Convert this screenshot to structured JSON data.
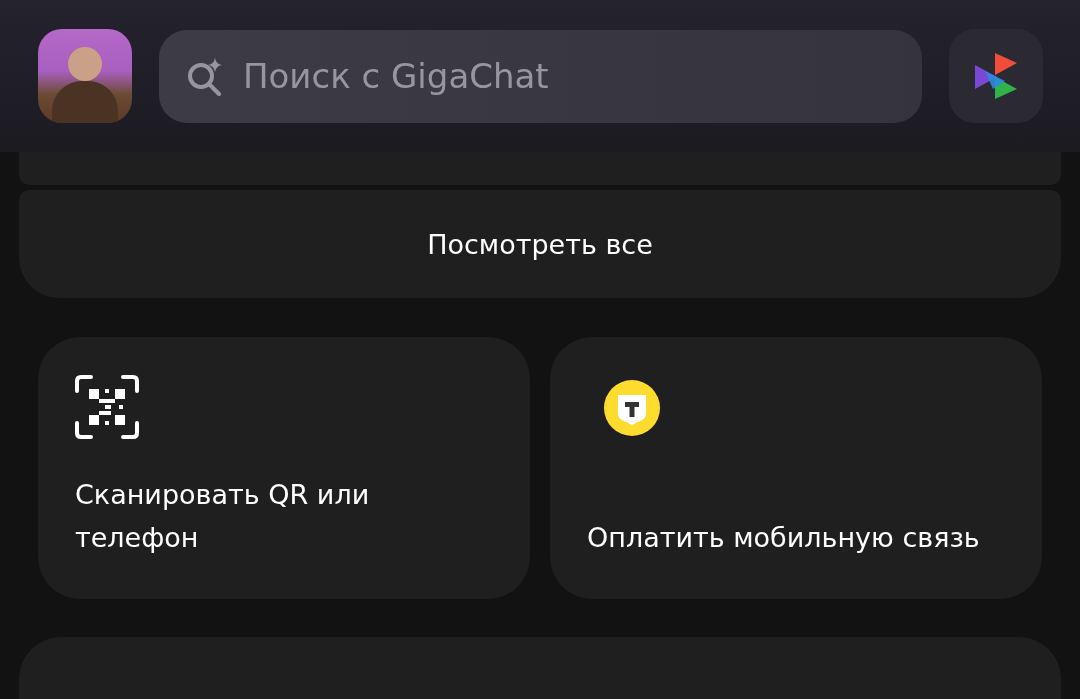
{
  "search": {
    "placeholder": "Поиск с GigaChat"
  },
  "view_all": {
    "label": "Посмотреть все"
  },
  "tiles": [
    {
      "kind": "qr",
      "label": "Сканировать QR или телефон"
    },
    {
      "kind": "operator",
      "label": "Оплатить мобильную связь"
    }
  ]
}
